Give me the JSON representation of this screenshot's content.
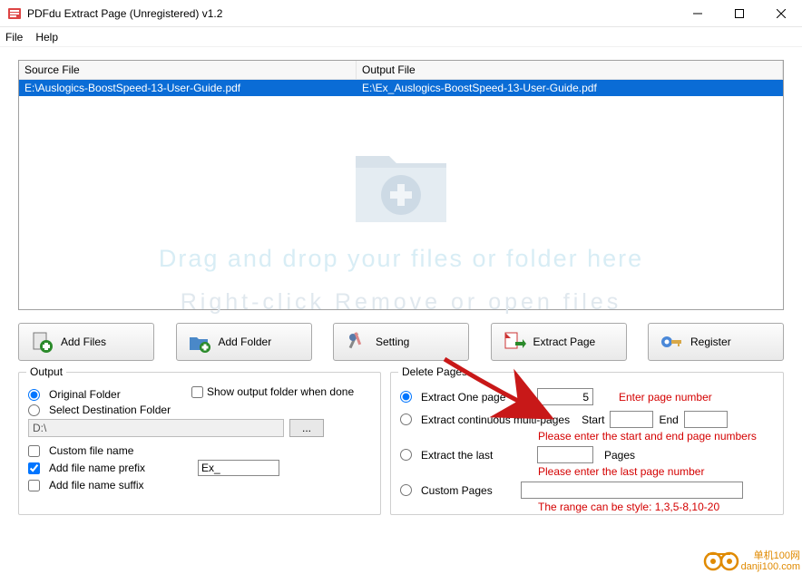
{
  "window": {
    "title": "PDFdu Extract Page (Unregistered) v1.2"
  },
  "menu": {
    "file": "File",
    "help": "Help"
  },
  "filelist": {
    "header_source": "Source File",
    "header_output": "Output File",
    "rows": [
      {
        "source": "E:\\Auslogics-BoostSpeed-13-User-Guide.pdf",
        "output": "E:\\Ex_Auslogics-BoostSpeed-13-User-Guide.pdf"
      }
    ],
    "drop_line1": "Drag and drop your files or folder here",
    "drop_line2": "Right-click Remove or open files"
  },
  "toolbar": {
    "add_files": "Add Files",
    "add_folder": "Add Folder",
    "setting": "Setting",
    "extract_page": "Extract Page",
    "register": "Register"
  },
  "output": {
    "title": "Output",
    "original_folder": "Original Folder",
    "select_dest": "Select Destination Folder",
    "path_value": "D:\\",
    "browse": "...",
    "custom_name": "Custom file name",
    "add_prefix": "Add file name prefix",
    "prefix_value": "Ex_",
    "add_suffix": "Add file name suffix",
    "show_when_done": "Show output folder when done"
  },
  "delete": {
    "title": "Delete Pages",
    "extract_one": "Extract One page",
    "one_value": "5",
    "one_hint": "Enter page number",
    "extract_multi": "Extract continuous multi-pages",
    "start_label": "Start",
    "end_label": "End",
    "multi_hint": "Please enter the start and end page numbers",
    "extract_last": "Extract the last",
    "pages_label": "Pages",
    "last_hint": "Please enter the last page number",
    "custom_pages": "Custom Pages",
    "custom_hint": "The range can be style:  1,3,5-8,10-20"
  },
  "watermark": {
    "line1": "单机100网",
    "line2": "danji100.com"
  }
}
